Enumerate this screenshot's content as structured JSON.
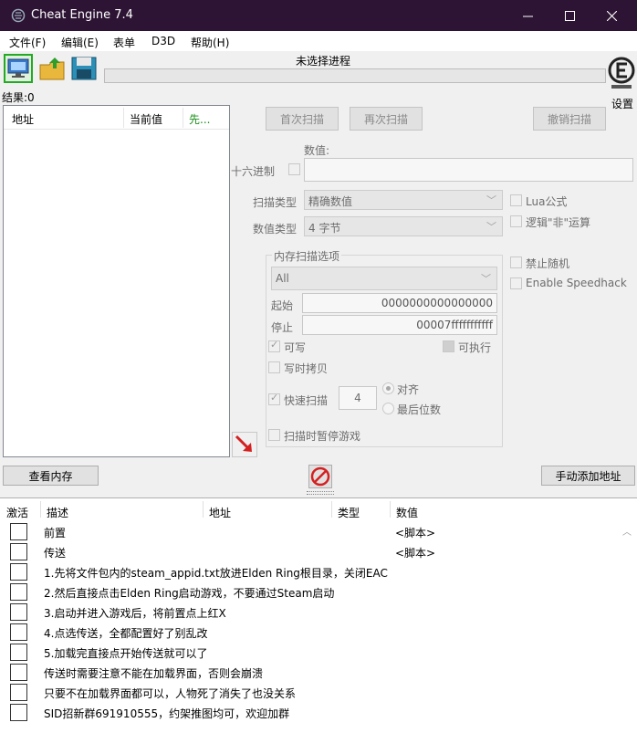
{
  "window": {
    "title": "Cheat Engine 7.4"
  },
  "menu": [
    "文件(F)",
    "编辑(E)",
    "表单",
    "D3D",
    "帮助(H)"
  ],
  "toolbar": {
    "process_label": "未选择进程",
    "settings_label": "设置"
  },
  "results_label": "结果:0",
  "address_list": {
    "col_address": "地址",
    "col_current": "当前值",
    "col_prev": "先..."
  },
  "scan": {
    "first_scan": "首次扫描",
    "next_scan": "再次扫描",
    "undo_scan": "撤销扫描",
    "value_label": "数值:",
    "hex_label": "十六进制",
    "scan_type_label": "扫描类型",
    "scan_type_value": "精确数值",
    "value_type_label": "数值类型",
    "value_type_value": "4 字节",
    "lua_formula": "Lua公式",
    "logic_not": "逻辑\"非\"运算",
    "no_random": "禁止随机",
    "speedhack": "Enable Speedhack",
    "mem_options_title": "内存扫描选项",
    "region_value": "All",
    "start_label": "起始",
    "start_value": "0000000000000000",
    "stop_label": "停止",
    "stop_value": "00007fffffffffff",
    "writable": "可写",
    "executable": "可执行",
    "copy_on_write": "写时拷贝",
    "fast_scan": "快速扫描",
    "fast_scan_value": "4",
    "align": "对齐",
    "last_digits": "最后位数",
    "pause_game": "扫描时暂停游戏"
  },
  "buttons": {
    "view_memory": "查看内存",
    "add_address": "手动添加地址"
  },
  "cheat_table": {
    "col_active": "激活",
    "col_desc": "描述",
    "col_address": "地址",
    "col_type": "类型",
    "col_value": "数值",
    "rows": [
      {
        "desc": "前置",
        "value": "<脚本>"
      },
      {
        "desc": "传送",
        "value": "<脚本>"
      },
      {
        "desc": "1.先将文件包内的steam_appid.txt放进Elden Ring根目录，关闭EAC",
        "value": ""
      },
      {
        "desc": "2.然后直接点击Elden Ring启动游戏，不要通过Steam启动",
        "value": ""
      },
      {
        "desc": "3.启动并进入游戏后，将前置点上红X",
        "value": ""
      },
      {
        "desc": "4.点选传送，全都配置好了别乱改",
        "value": ""
      },
      {
        "desc": "5.加载完直接点开始传送就可以了",
        "value": ""
      },
      {
        "desc": "传送时需要注意不能在加载界面，否则会崩溃",
        "value": ""
      },
      {
        "desc": "只要不在加载界面都可以，人物死了消失了也没关系",
        "value": ""
      },
      {
        "desc": "SID招新群691910555，约架推图均可，欢迎加群",
        "value": ""
      }
    ]
  },
  "colors": {
    "titlebar": "#2d1434",
    "accent_green": "#1a8f1a",
    "arrow_red": "#d42020"
  }
}
